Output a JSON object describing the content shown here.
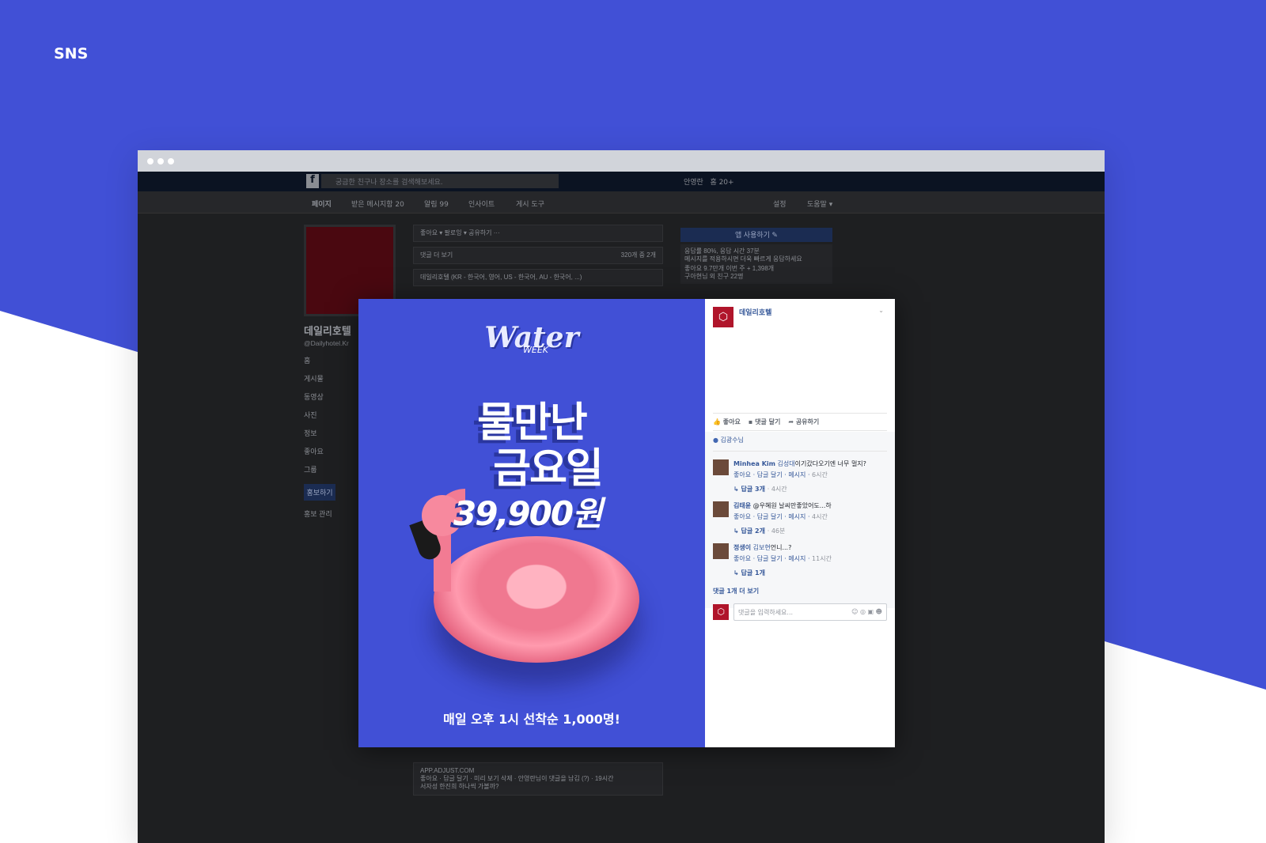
{
  "page_label": "SNS",
  "fb": {
    "logo": "f",
    "search_placeholder": "궁금한 친구나 장소를 검색해보세요.",
    "user": "안영란",
    "home_count": "홈 20+",
    "tabs": [
      "페이지",
      "받은 메시지함 20",
      "알림 99",
      "인사이트",
      "게시 도구"
    ],
    "tabs_right": [
      "설정",
      "도움말 ▾"
    ],
    "page_name": "데일리호텔",
    "page_handle": "@Dailyhotel.Kr",
    "nav": [
      "홈",
      "게시물",
      "동영상",
      "사진",
      "정보",
      "좋아요",
      "그룹"
    ],
    "promote": "홍보하기",
    "promo_manage": "홍보 관리",
    "center_actions": "좋아요 ▾   팔로잉 ▾   공유하기   ···",
    "more_comments": "댓글 더 보기",
    "comment_count": "320개 중 2개",
    "post_title": "데일리호텔 (KR - 한국어, 영어, US - 한국어, AU - 한국어, ...)",
    "link_domain": "APP.ADJUST.COM",
    "bottom_meta": "좋아요 · 답글 달기 · 미리 보기 삭제 · 안영란님이 댓글을 남김 (?) · 19시간",
    "bottom_comment": "서자성 한진희 하나씩 가볼까?",
    "app_button": "앱 사용하기 ✎",
    "response": "응답률 80%, 응답 시간 37분",
    "response_sub": "메시지를 적용하시면 더욱 빠르게 응답하세요",
    "likes": "좋아요 9.7만개 이번 주 + 1,398개",
    "friends": "구아현님 외 친구 22명"
  },
  "ad": {
    "logo_word": "Water",
    "logo_sub": "WEEK",
    "headline1": "물만난",
    "headline2": "금요일",
    "price": "39,900원",
    "bottom": "매일 오후 1시 선착순 1,000명!"
  },
  "post": {
    "page_name": "데일리호텔",
    "like": "좋아요",
    "comment": "댓글 달기",
    "share": "공유하기",
    "liked_by": "김광수님",
    "comments": [
      {
        "author": "Minhea Kim",
        "tag": "김성대",
        "text": "이기갔다오기엔 너무 멀지?",
        "time": "6시간",
        "replies": "답글 3개",
        "reply_time": "· 4시간"
      },
      {
        "author": "김태윤",
        "tag": "",
        "text": "@우혜원 날씨만좋았어도...하",
        "time": "4시간",
        "replies": "답글 2개",
        "reply_time": "· 46분"
      },
      {
        "author": "정생이",
        "tag": "김보현",
        "text": "언니...?",
        "time": "11시간",
        "replies": "답글 1개",
        "reply_time": ""
      }
    ],
    "meta_actions": "좋아요 · 답글 달기 · 메시지 · ",
    "more": "댓글 1개 더 보기",
    "input_placeholder": "댓글을 입력하세요...",
    "input_icons": "☺ ◎ ▣ ☻"
  }
}
